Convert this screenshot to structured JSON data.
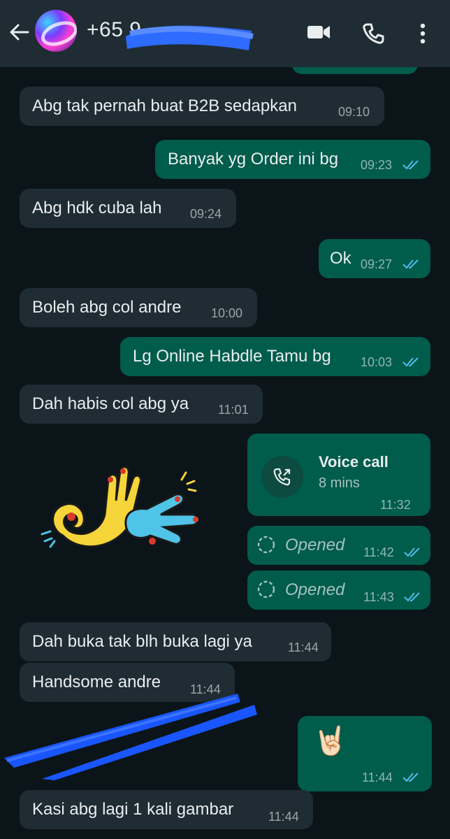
{
  "header": {
    "contact_name": "+65 9",
    "icons": [
      "back-arrow-icon",
      "video-call-icon",
      "phone-icon",
      "more-options-icon"
    ]
  },
  "messages": [
    {
      "dir": "in",
      "text": "Abg tak pernah buat B2B sedapkan",
      "time": "09:10"
    },
    {
      "dir": "out",
      "text": "Banyak yg Order ini bg",
      "time": "09:23",
      "read": true
    },
    {
      "dir": "in",
      "text": "Abg hdk cuba lah",
      "time": "09:24"
    },
    {
      "dir": "out",
      "text": "Ok",
      "time": "09:27",
      "read": true
    },
    {
      "dir": "in",
      "text": "Boleh abg col andre",
      "time": "10:00"
    },
    {
      "dir": "out",
      "text": "Lg Online Habdle Tamu bg",
      "time": "10:03",
      "read": true
    },
    {
      "dir": "in",
      "text": "Dah habis col abg ya",
      "time": "11:01"
    },
    {
      "dir": "out",
      "type": "voice_call",
      "title": "Voice call",
      "duration": "8 mins",
      "time": "11:32"
    },
    {
      "dir": "in",
      "type": "sticker",
      "sticker": "ok-hand-sticker"
    },
    {
      "dir": "out",
      "type": "view_once",
      "text": "Opened",
      "time": "11:42",
      "read": true
    },
    {
      "dir": "out",
      "type": "view_once",
      "text": "Opened",
      "time": "11:43",
      "read": true
    },
    {
      "dir": "in",
      "text": "Dah buka tak blh buka lagi ya",
      "time": "11:44"
    },
    {
      "dir": "in",
      "text": "Handsome andre",
      "time": "11:44"
    },
    {
      "dir": "out",
      "type": "emoji",
      "emoji": "🤘🏻",
      "time": "11:44",
      "read": true
    },
    {
      "dir": "in",
      "text": "Kasi abg lagi 1 kali gambar",
      "time": "11:44"
    }
  ],
  "colors": {
    "header_bg": "#1f2c33",
    "chat_bg": "#0b1418",
    "incoming_bubble": "#1f2c33",
    "outgoing_bubble": "#005c4b",
    "read_tick": "#53bdeb",
    "redaction_scribble": "#1a5cff"
  }
}
